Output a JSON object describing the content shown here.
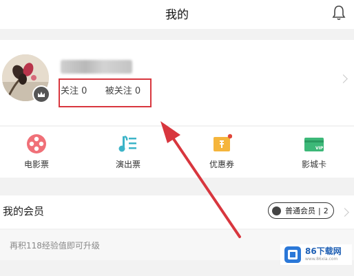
{
  "header": {
    "title": "我的"
  },
  "profile": {
    "following_label": "关注",
    "following_count": "0",
    "followers_label": "被关注",
    "followers_count": "0"
  },
  "quick_links": [
    {
      "label": "电影票",
      "icon": "film-reel-icon",
      "color": "#f07078"
    },
    {
      "label": "演出票",
      "icon": "music-list-icon",
      "color": "#3cb4c8"
    },
    {
      "label": "优惠券",
      "icon": "coupon-icon",
      "color": "#f5b53c"
    },
    {
      "label": "影城卡",
      "icon": "vip-card-icon",
      "color": "#3cb878"
    }
  ],
  "member": {
    "title": "我的会员",
    "level": "普通会员",
    "level_num": "2",
    "upgrade_hint": "再积118经验值即可升级"
  },
  "watermark": {
    "text": "86下载网",
    "sub": "www.86xia.com"
  },
  "colors": {
    "annotation": "#d8363e"
  }
}
